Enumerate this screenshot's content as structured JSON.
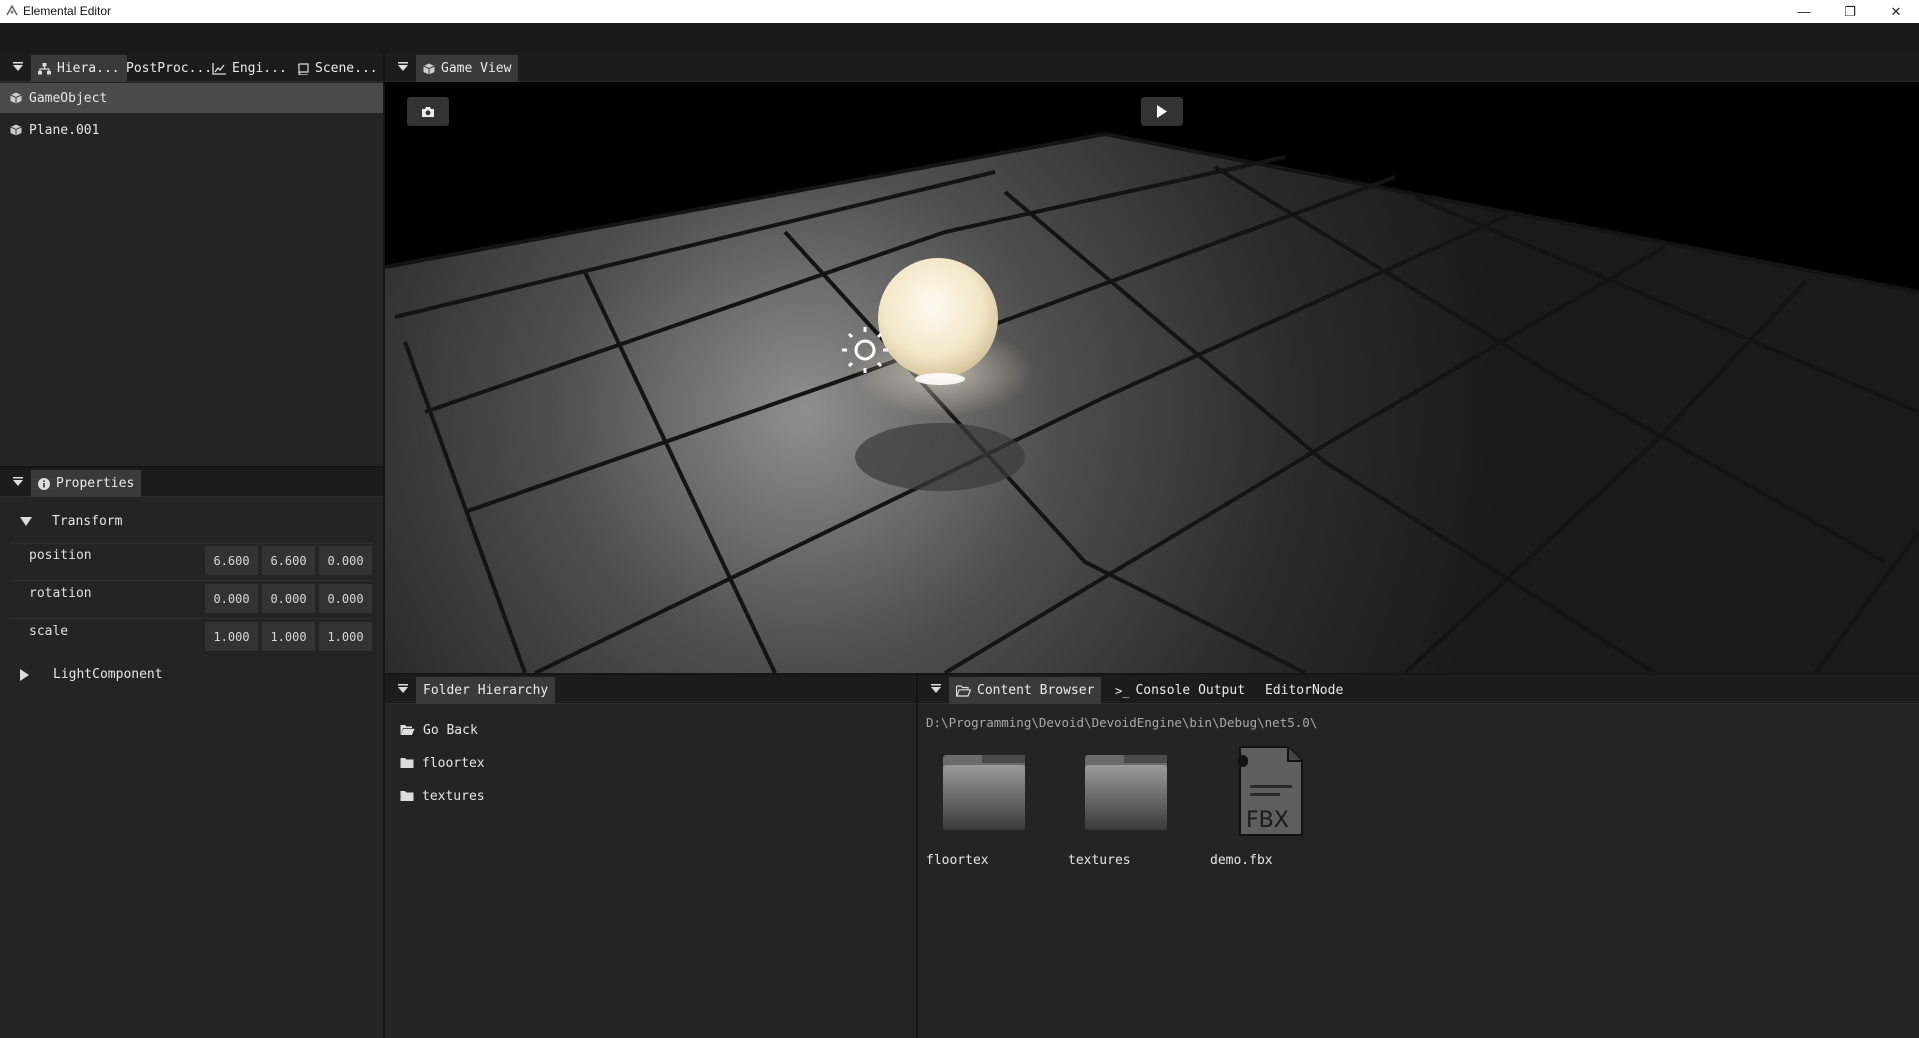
{
  "window": {
    "title": "Elemental Editor",
    "minimize": "—",
    "maximize": "❐",
    "close": "✕"
  },
  "left_top_panel": {
    "tabs": [
      {
        "label": "Hiera...",
        "icon": "hierarchy-icon",
        "active": true
      },
      {
        "label": "PostProc...",
        "icon": "",
        "active": false
      },
      {
        "label": "Engi...",
        "icon": "chart-icon",
        "active": false
      },
      {
        "label": "Scene...",
        "icon": "book-icon",
        "active": false
      }
    ],
    "items": [
      {
        "label": "GameObject",
        "icon": "cube-icon",
        "selected": true
      },
      {
        "label": "Plane.001",
        "icon": "cube-icon",
        "selected": false
      }
    ]
  },
  "properties_panel": {
    "tab_label": "Properties",
    "transform_label": "Transform",
    "rows": [
      {
        "label": "position",
        "values": [
          "6.600",
          "6.600",
          "0.000"
        ]
      },
      {
        "label": "rotation",
        "values": [
          "0.000",
          "0.000",
          "0.000"
        ]
      },
      {
        "label": "scale",
        "values": [
          "1.000",
          "1.000",
          "1.000"
        ]
      }
    ],
    "light_component_label": "LightComponent"
  },
  "game_view": {
    "tab_label": "Game View",
    "camera_button_icon": "camera-icon",
    "play_button_icon": "play-icon"
  },
  "folder_hierarchy": {
    "tab_label": "Folder Hierarchy",
    "items": [
      {
        "label": "Go Back",
        "icon": "folder-open-icon"
      },
      {
        "label": "floortex",
        "icon": "folder-icon"
      },
      {
        "label": "textures",
        "icon": "folder-icon"
      }
    ]
  },
  "content_browser": {
    "tabs": [
      {
        "label": "Content Browser",
        "icon": "folder-open-icon",
        "active": true
      },
      {
        "label": "Console Output",
        "icon": "terminal-icon",
        "active": false
      },
      {
        "label": "EditorNode",
        "icon": "",
        "active": false
      }
    ],
    "path": "D:\\Programming\\Devoid\\DevoidEngine\\bin\\Debug\\net5.0\\",
    "assets": [
      {
        "label": "floortex",
        "type": "folder"
      },
      {
        "label": "textures",
        "type": "folder"
      },
      {
        "label": "demo.fbx",
        "type": "fbx",
        "badge": "FBX"
      }
    ]
  },
  "colors": {
    "panel_bg": "#242424",
    "tab_active": "#3a3a3a",
    "selected_row": "#4a4a4a",
    "field_bg": "#333333"
  }
}
